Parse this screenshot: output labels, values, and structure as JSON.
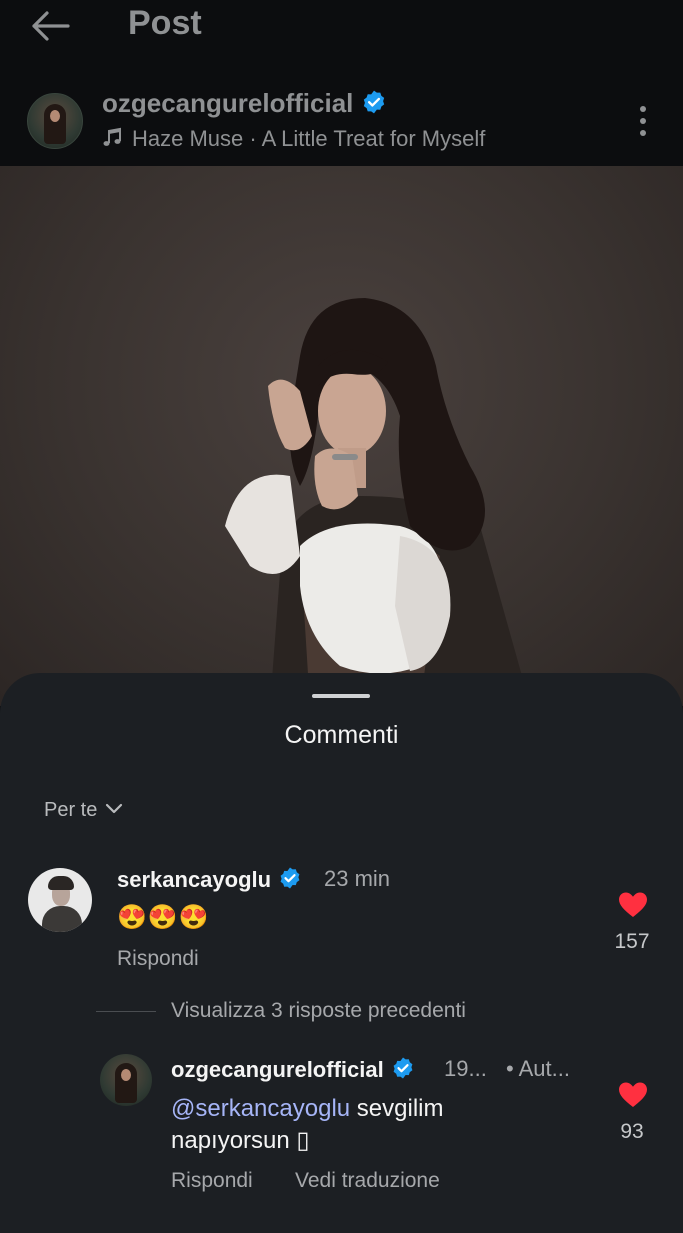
{
  "header": {
    "title": "Post"
  },
  "post": {
    "username": "ozgecangurelofficial",
    "music": "Haze Muse · A Little Treat for Myself"
  },
  "comments_sheet": {
    "title": "Commenti",
    "sort_label": "Per te",
    "comments": [
      {
        "username": "serkancayoglu",
        "time": "23 min",
        "text": "😍😍😍",
        "reply_label": "Rispondi",
        "likes": "157"
      }
    ],
    "view_replies_label": "Visualizza 3 risposte precedenti",
    "replies": [
      {
        "username": "ozgecangurelofficial",
        "time": "19...",
        "author_tag": "• Aut...",
        "mention": "@serkancayoglu",
        "text": " sevgilim napıyorsun ▯",
        "reply_label": "Rispondi",
        "translate_label": "Vedi traduzione",
        "likes": "93"
      }
    ]
  },
  "colors": {
    "background": "#0c0d0f",
    "sheet": "#1c1f23",
    "verified": "#1d9bf0",
    "heart": "#ff3040",
    "mention": "#a6b5f7"
  },
  "icons": [
    "back-arrow-icon",
    "verified-icon",
    "music-note-icon",
    "more-vertical-icon",
    "chevron-down-icon",
    "heart-icon"
  ]
}
